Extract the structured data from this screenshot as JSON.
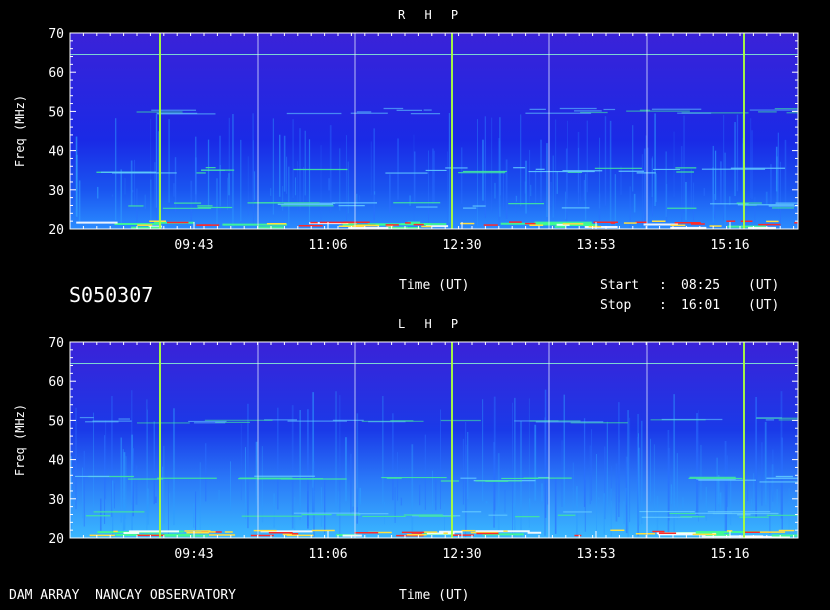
{
  "chart_data": [
    {
      "type": "heatmap",
      "title": "R H P",
      "ylabel": "Freq (MHz)",
      "xlabel": "Time (UT)",
      "ylim": [
        20,
        70
      ],
      "yticks": [
        "20",
        "30",
        "40",
        "50",
        "60",
        "70"
      ],
      "xticks": [
        "09:43",
        "11:06",
        "12:30",
        "13:53",
        "15:16"
      ],
      "x_range": [
        "08:25",
        "16:01"
      ],
      "emission_bands_MHz": [
        21,
        26,
        35,
        50
      ],
      "colors": {
        "background": "#1a22e6",
        "noise": "#3aa0ff",
        "band": "#50ffa0",
        "intense": "#ff2020"
      }
    },
    {
      "type": "heatmap",
      "title": "L H P",
      "ylabel": "Freq (MHz)",
      "xlabel": "Time (UT)",
      "ylim": [
        20,
        70
      ],
      "yticks": [
        "20",
        "30",
        "40",
        "50",
        "60",
        "70"
      ],
      "xticks": [
        "09:43",
        "11:06",
        "12:30",
        "13:53",
        "15:16"
      ],
      "x_range": [
        "08:25",
        "16:01"
      ],
      "emission_bands_MHz": [
        21,
        26,
        35,
        50
      ],
      "colors": {
        "background": "#1a22e6",
        "noise": "#3aa0ff",
        "band": "#50ffa0",
        "intense": "#ff2020"
      }
    }
  ],
  "header": {
    "date_code": "S050307",
    "time_label": "Time (UT)",
    "start_label": "Start",
    "stop_label": "Stop",
    "colon": ":",
    "start_value": "08:25",
    "stop_value": "16:01",
    "unit": "(UT)"
  },
  "footer": {
    "observatory": "DAM ARRAY  NANCAY OBSERVATORY",
    "time_label": "Time (UT)"
  }
}
